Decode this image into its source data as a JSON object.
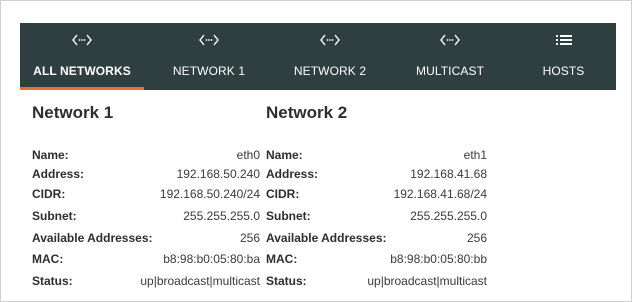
{
  "tabs": [
    {
      "label": "ALL NETWORKS",
      "icon": "code-arrows-icon",
      "active": true
    },
    {
      "label": "NETWORK 1",
      "icon": "code-arrows-icon",
      "active": false
    },
    {
      "label": "NETWORK 2",
      "icon": "code-arrows-icon",
      "active": false
    },
    {
      "label": "MULTICAST",
      "icon": "code-arrows-icon",
      "active": false
    },
    {
      "label": "HOSTS",
      "icon": "list-icon",
      "active": false
    }
  ],
  "colors": {
    "navbar_bg": "#2f3e3f",
    "active_indicator": "#ef6c2f",
    "text": "#2e2e2e"
  },
  "networks": [
    {
      "title": "Network 1",
      "fields": [
        {
          "key": "Name:",
          "value": "eth0"
        },
        {
          "key": "Address:",
          "value": "192.168.50.240"
        },
        {
          "key": "CIDR:",
          "value": "192.168.50.240/24"
        },
        {
          "key": "Subnet:",
          "value": "255.255.255.0"
        },
        {
          "key": "Available Addresses:",
          "value": "256"
        },
        {
          "key": "MAC:",
          "value": "b8:98:b0:05:80:ba"
        },
        {
          "key": "Status:",
          "value": "up|broadcast|multicast"
        }
      ]
    },
    {
      "title": "Network 2",
      "fields": [
        {
          "key": "Name:",
          "value": "eth1"
        },
        {
          "key": "Address:",
          "value": "192.168.41.68"
        },
        {
          "key": "CIDR:",
          "value": "192.168.41.68/24"
        },
        {
          "key": "Subnet:",
          "value": "255.255.255.0"
        },
        {
          "key": "Available Addresses:",
          "value": "256"
        },
        {
          "key": "MAC:",
          "value": "b8:98:b0:05:80:bb"
        },
        {
          "key": "Status:",
          "value": "up|broadcast|multicast"
        }
      ]
    }
  ]
}
